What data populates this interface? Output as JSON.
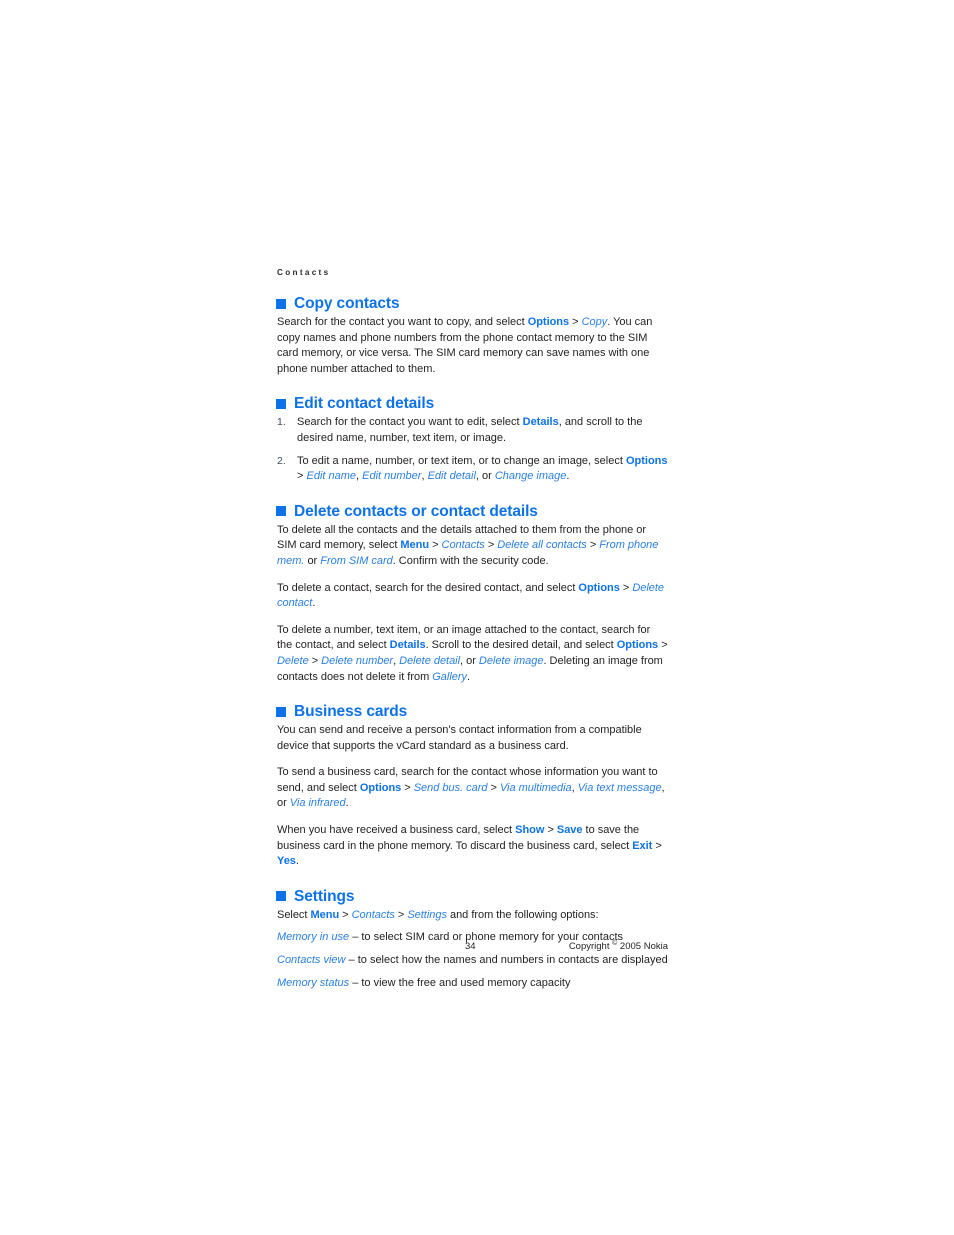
{
  "running_head": "Contacts",
  "sections": [
    {
      "id": "copy-contacts",
      "heading": "Copy contacts",
      "paragraphs": [
        {
          "runs": [
            {
              "t": "Search for the contact you want to copy, and select ",
              "s": "plain"
            },
            {
              "t": "Options",
              "s": "bold"
            },
            {
              "t": " > ",
              "s": "sep"
            },
            {
              "t": "Copy",
              "s": "italic"
            },
            {
              "t": ". You can copy names and phone numbers from the phone contact memory to the SIM card memory, or vice versa. The SIM card memory can save names with one phone number attached to them.",
              "s": "plain"
            }
          ]
        }
      ]
    },
    {
      "id": "edit-contact-details",
      "heading": "Edit contact details",
      "list": [
        {
          "marker": "1.",
          "runs": [
            {
              "t": "Search for the contact you want to edit, select ",
              "s": "plain"
            },
            {
              "t": "Details",
              "s": "bold"
            },
            {
              "t": ", and scroll to the desired name, number, text item, or image.",
              "s": "plain"
            }
          ]
        },
        {
          "marker": "2.",
          "runs": [
            {
              "t": "To edit a name, number, or text item, or to change an image, select ",
              "s": "plain"
            },
            {
              "t": "Options",
              "s": "bold"
            },
            {
              "t": " > ",
              "s": "sep"
            },
            {
              "t": "Edit name",
              "s": "italic"
            },
            {
              "t": ", ",
              "s": "sep"
            },
            {
              "t": "Edit number",
              "s": "italic"
            },
            {
              "t": ", ",
              "s": "sep"
            },
            {
              "t": "Edit detail",
              "s": "italic"
            },
            {
              "t": ", or ",
              "s": "plain"
            },
            {
              "t": "Change image",
              "s": "italic"
            },
            {
              "t": ".",
              "s": "plain"
            }
          ]
        }
      ]
    },
    {
      "id": "delete-contacts-or-contact-details",
      "heading": "Delete contacts or contact details",
      "paragraphs": [
        {
          "runs": [
            {
              "t": "To delete all the contacts and the details attached to them from the phone or SIM card memory, select ",
              "s": "plain"
            },
            {
              "t": "Menu",
              "s": "bold"
            },
            {
              "t": " > ",
              "s": "sep"
            },
            {
              "t": "Contacts",
              "s": "italic"
            },
            {
              "t": " > ",
              "s": "sep"
            },
            {
              "t": "Delete all contacts",
              "s": "italic"
            },
            {
              "t": " > ",
              "s": "sep"
            },
            {
              "t": "From phone mem.",
              "s": "italic"
            },
            {
              "t": " or ",
              "s": "plain"
            },
            {
              "t": "From SIM card",
              "s": "italic"
            },
            {
              "t": ". Confirm with the security code.",
              "s": "plain"
            }
          ]
        },
        {
          "runs": [
            {
              "t": "To delete a contact, search for the desired contact, and select ",
              "s": "plain"
            },
            {
              "t": "Options",
              "s": "bold"
            },
            {
              "t": " > ",
              "s": "sep"
            },
            {
              "t": "Delete contact",
              "s": "italic"
            },
            {
              "t": ".",
              "s": "plain"
            }
          ]
        },
        {
          "runs": [
            {
              "t": "To delete a number, text item, or an image attached to the contact, search for the contact, and select ",
              "s": "plain"
            },
            {
              "t": "Details",
              "s": "bold"
            },
            {
              "t": ". Scroll to the desired detail, and select ",
              "s": "plain"
            },
            {
              "t": "Options",
              "s": "bold"
            },
            {
              "t": " > ",
              "s": "sep"
            },
            {
              "t": "Delete",
              "s": "italic"
            },
            {
              "t": " > ",
              "s": "sep"
            },
            {
              "t": "Delete number",
              "s": "italic"
            },
            {
              "t": ", ",
              "s": "sep"
            },
            {
              "t": "Delete detail",
              "s": "italic"
            },
            {
              "t": ", or ",
              "s": "plain"
            },
            {
              "t": "Delete image",
              "s": "italic"
            },
            {
              "t": ". Deleting an image from contacts does not delete it from ",
              "s": "plain"
            },
            {
              "t": "Gallery",
              "s": "italic"
            },
            {
              "t": ".",
              "s": "plain"
            }
          ]
        }
      ]
    },
    {
      "id": "business-cards",
      "heading": "Business cards",
      "paragraphs": [
        {
          "runs": [
            {
              "t": "You can send and receive a person's contact information from a compatible device that supports the vCard standard as a business card.",
              "s": "plain"
            }
          ]
        },
        {
          "runs": [
            {
              "t": "To send a business card, search for the contact whose information you want to send, and select ",
              "s": "plain"
            },
            {
              "t": "Options",
              "s": "bold"
            },
            {
              "t": " > ",
              "s": "sep"
            },
            {
              "t": "Send bus. card",
              "s": "italic"
            },
            {
              "t": " > ",
              "s": "sep"
            },
            {
              "t": "Via multimedia",
              "s": "italic"
            },
            {
              "t": ", ",
              "s": "sep"
            },
            {
              "t": "Via text message",
              "s": "italic"
            },
            {
              "t": ", or ",
              "s": "plain"
            },
            {
              "t": "Via infrared",
              "s": "italic"
            },
            {
              "t": ".",
              "s": "plain"
            }
          ]
        },
        {
          "runs": [
            {
              "t": "When you have received a business card, select ",
              "s": "plain"
            },
            {
              "t": "Show",
              "s": "bold"
            },
            {
              "t": " > ",
              "s": "sep"
            },
            {
              "t": "Save",
              "s": "bold"
            },
            {
              "t": " to save the business card in the phone memory. To discard the business card, select ",
              "s": "plain"
            },
            {
              "t": "Exit",
              "s": "bold"
            },
            {
              "t": " > ",
              "s": "sep"
            },
            {
              "t": "Yes",
              "s": "bold"
            },
            {
              "t": ".",
              "s": "plain"
            }
          ]
        }
      ]
    },
    {
      "id": "settings",
      "heading": "Settings",
      "paragraphs": [
        {
          "runs": [
            {
              "t": "Select ",
              "s": "plain"
            },
            {
              "t": "Menu",
              "s": "bold"
            },
            {
              "t": " > ",
              "s": "sep"
            },
            {
              "t": "Contacts",
              "s": "italic"
            },
            {
              "t": " > ",
              "s": "sep"
            },
            {
              "t": "Settings",
              "s": "italic"
            },
            {
              "t": " and from the following options:",
              "s": "plain"
            }
          ]
        }
      ],
      "options": [
        {
          "runs": [
            {
              "t": "Memory in use",
              "s": "italic"
            },
            {
              "t": " – to select SIM card or phone memory for your contacts",
              "s": "plain"
            }
          ]
        },
        {
          "runs": [
            {
              "t": "Contacts view",
              "s": "italic"
            },
            {
              "t": " – to select how the names and numbers in contacts are displayed",
              "s": "plain"
            }
          ]
        },
        {
          "runs": [
            {
              "t": "Memory status",
              "s": "italic"
            },
            {
              "t": " – to view the free and used memory capacity",
              "s": "plain"
            }
          ]
        }
      ]
    }
  ],
  "footer": {
    "page_number": "34",
    "copyright_prefix": "Copyright ",
    "copyright_symbol": "©",
    "copyright_suffix": " 2005 Nokia"
  },
  "colors": {
    "heading_blue": "#0d72e8",
    "ui_bold_blue": "#0d72e8",
    "ui_italic_blue": "#2a7fe0",
    "body_text": "#231f20",
    "list_number": "#3d4c5c",
    "page_background": "#ffffff"
  }
}
